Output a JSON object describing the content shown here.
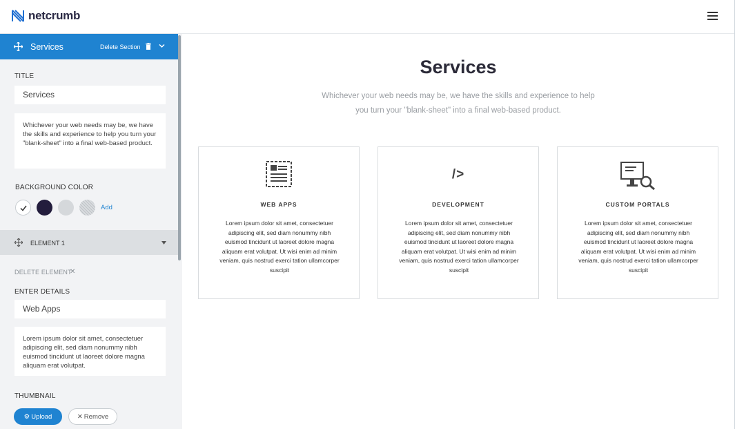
{
  "app": {
    "brand": "netcrumb"
  },
  "sidebar": {
    "section": {
      "title": "Services",
      "delete_label": "Delete Section"
    },
    "title_label": "TITLE",
    "title_value": "Services",
    "description_value": "Whichever your web needs may be, we have the skills and experience to help you turn your \"blank-sheet\" into a final web-based product.",
    "bg_color_label": "BACKGROUND COLOR",
    "bg_colors": [
      "#ffffff",
      "#231d3d",
      "#d5d8db",
      "#c8cbce"
    ],
    "add_label": "Add",
    "element": {
      "title": "ELEMENT 1",
      "delete_label": "DELETE ELEMENT",
      "delete_x": "✕"
    },
    "details_label": "ENTER DETAILS",
    "details_title": "Web Apps",
    "details_text": "Lorem ipsum dolor sit amet, consectetuer adipiscing elit, sed diam nonummy nibh euismod tincidunt ut laoreet dolore magna aliquam erat volutpat.",
    "thumbnail_label": "THUMBNAIL",
    "upload_label": "Upload",
    "remove_label": "Remove"
  },
  "main": {
    "title": "Services",
    "subtitle": "Whichever your web needs may be, we have the skills and experience to help you turn your \"blank-sheet\" into a final web-based product.",
    "cards": [
      {
        "icon": "browser-layout-icon",
        "title": "WEB APPS",
        "text": "Lorem ipsum dolor sit amet, consectetuer adipiscing elit, sed diam nonummy nibh euismod tincidunt ut laoreet dolore magna aliquam erat volutpat. Ut wisi enim ad minim veniam, quis nostrud exerci tation ullamcorper suscipit"
      },
      {
        "icon": "code-icon",
        "title": "DEVELOPMENT",
        "text": "Lorem ipsum dolor sit amet, consectetuer adipiscing elit, sed diam nonummy nibh euismod tincidunt ut laoreet dolore magna aliquam erat volutpat. Ut wisi enim ad minim veniam, quis nostrud exerci tation ullamcorper suscipit",
        "glyph": "/>"
      },
      {
        "icon": "monitor-search-icon",
        "title": "CUSTOM PORTALS",
        "text": "Lorem ipsum dolor sit amet, consectetuer adipiscing elit, sed diam nonummy nibh euismod tincidunt ut laoreet dolore magna aliquam erat volutpat. Ut wisi enim ad minim veniam, quis nostrud exerci tation ullamcorper suscipit"
      }
    ]
  },
  "colors": {
    "accent": "#1f83d1",
    "heading": "#2b2a38",
    "sidebar_bg": "#f2f3f5"
  }
}
